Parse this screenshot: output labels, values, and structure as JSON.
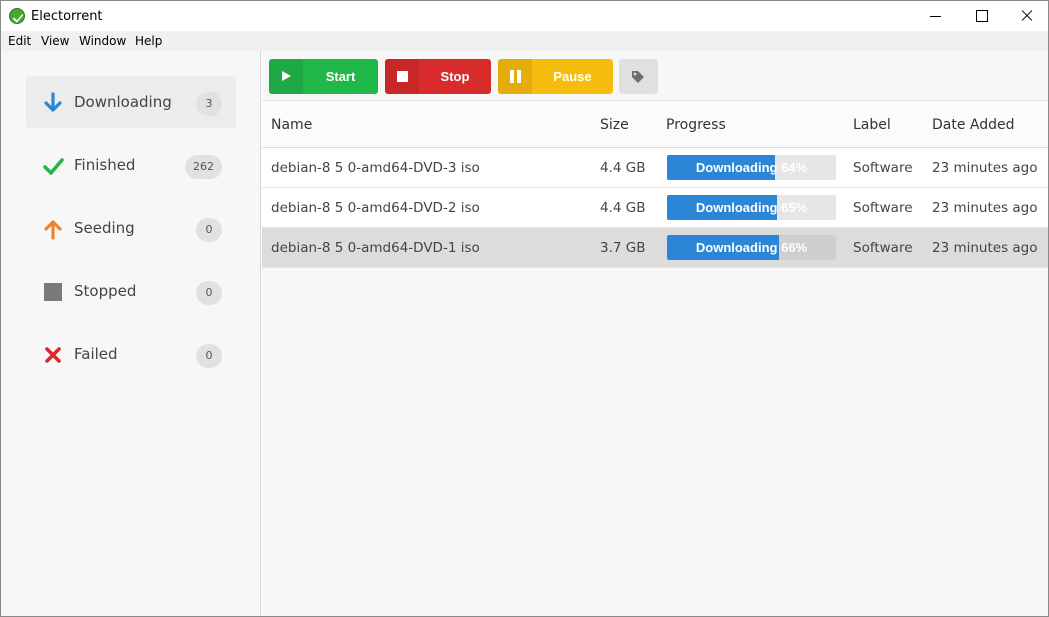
{
  "window": {
    "title": "Electorrent",
    "controls": [
      "minimize",
      "maximize",
      "close"
    ]
  },
  "menu": [
    {
      "label": "Edit"
    },
    {
      "label": "View"
    },
    {
      "label": "Window"
    },
    {
      "label": "Help"
    }
  ],
  "sidebar": {
    "items": [
      {
        "label": "Downloading",
        "count": "3",
        "icon": "arrow-down-icon",
        "color": "#2c86d6",
        "active": true
      },
      {
        "label": "Finished",
        "count": "262",
        "icon": "checkmark-icon",
        "color": "#21b84a",
        "active": false
      },
      {
        "label": "Seeding",
        "count": "0",
        "icon": "arrow-up-icon",
        "color": "#f0822a",
        "active": false
      },
      {
        "label": "Stopped",
        "count": "0",
        "icon": "square-icon",
        "color": "#7a7a7a",
        "active": false
      },
      {
        "label": "Failed",
        "count": "0",
        "icon": "x-icon",
        "color": "#d82b2b",
        "active": false
      }
    ]
  },
  "toolbar": {
    "start_label": "Start",
    "stop_label": "Stop",
    "pause_label": "Pause",
    "colors": {
      "start": "#21b84a",
      "stop": "#d82b2b",
      "pause": "#f7bd0e",
      "label": "#e0e0e0"
    }
  },
  "table": {
    "headers": {
      "name": "Name",
      "size": "Size",
      "progress": "Progress",
      "label": "Label",
      "date_added": "Date Added"
    },
    "rows": [
      {
        "name": "debian-8 5 0-amd64-DVD-3 iso",
        "size": "4.4 GB",
        "progress_text": "Downloading 64%",
        "progress": 0.64,
        "label": "Software",
        "date_added": "23 minutes ago",
        "selected": false
      },
      {
        "name": "debian-8 5 0-amd64-DVD-2 iso",
        "size": "4.4 GB",
        "progress_text": "Downloading 65%",
        "progress": 0.65,
        "label": "Software",
        "date_added": "23 minutes ago",
        "selected": false
      },
      {
        "name": "debian-8 5 0-amd64-DVD-1 iso",
        "size": "3.7 GB",
        "progress_text": "Downloading 66%",
        "progress": 0.66,
        "label": "Software",
        "date_added": "23 minutes ago",
        "selected": true
      }
    ]
  }
}
